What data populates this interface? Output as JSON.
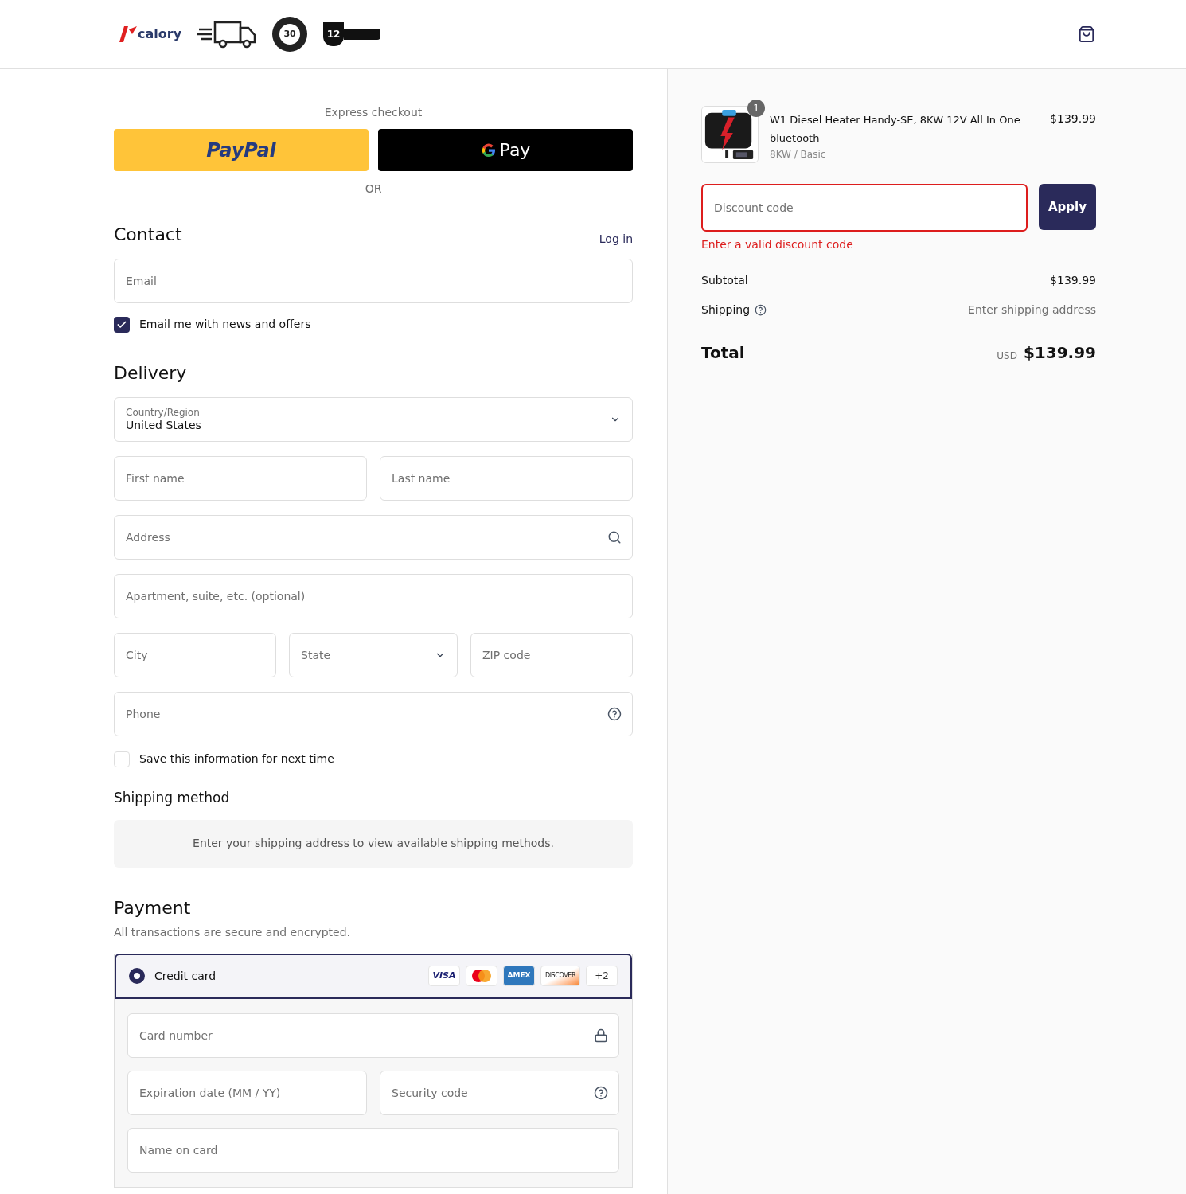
{
  "header": {
    "logo": "calory",
    "badges": [
      {
        "kind": "truck"
      },
      {
        "kind": "days",
        "text": "30"
      },
      {
        "kind": "warranty",
        "text": "12"
      }
    ]
  },
  "express": {
    "title": "Express checkout",
    "buttons": [
      {
        "kind": "paypal",
        "label": "PayPal"
      },
      {
        "kind": "gpay",
        "label": "Pay"
      }
    ],
    "divider": "OR"
  },
  "contact": {
    "heading": "Contact",
    "link": "Log in",
    "email": {
      "kind": "email",
      "placeholder": "Email"
    },
    "newsletter": {
      "label": "Email me with news and offers",
      "checked": true
    }
  },
  "delivery": {
    "heading": "Delivery",
    "rows": [
      [
        {
          "kind": "select",
          "label": "Country/Region",
          "value": "United States"
        }
      ],
      [
        {
          "kind": "input",
          "placeholder": "First name"
        },
        {
          "kind": "input",
          "placeholder": "Last name"
        }
      ],
      [
        {
          "kind": "address",
          "placeholder": "Address"
        }
      ],
      [
        {
          "kind": "input",
          "placeholder": "Apartment, suite, etc. (optional)"
        }
      ],
      [
        {
          "kind": "input",
          "placeholder": "City"
        },
        {
          "kind": "select",
          "placeholder": "State"
        },
        {
          "kind": "input",
          "placeholder": "ZIP code"
        }
      ],
      [
        {
          "kind": "phone",
          "placeholder": "Phone"
        }
      ]
    ],
    "save": {
      "label": "Save this information for next time",
      "checked": false
    }
  },
  "shipping_method": {
    "heading": "Shipping method",
    "notice": "Enter your shipping address to view available shipping methods."
  },
  "payment": {
    "heading": "Payment",
    "subtitle": "All transactions are secure and encrypted.",
    "method": {
      "label": "Credit card",
      "selected": true,
      "brands": [
        {
          "kind": "visa",
          "text": "VISA"
        },
        {
          "kind": "mastercard"
        },
        {
          "kind": "amex",
          "text": "AMEX"
        },
        {
          "kind": "discover",
          "text": "DISCOVER"
        },
        {
          "kind": "more",
          "text": "+2"
        }
      ]
    },
    "rows": [
      [
        {
          "kind": "card",
          "placeholder": "Card number"
        }
      ],
      [
        {
          "kind": "input",
          "placeholder": "Expiration date (MM / YY)"
        },
        {
          "kind": "cvc",
          "placeholder": "Security code"
        }
      ],
      [
        {
          "kind": "input",
          "placeholder": "Name on card"
        }
      ]
    ]
  },
  "summary": {
    "product": {
      "name": "W1 Diesel Heater Handy-SE, 8KW 12V All In One bluetooth",
      "variant": "8KW / Basic",
      "price": "$139.99",
      "quantity": "1"
    },
    "discount": {
      "placeholder": "Discount code",
      "invalid": true,
      "error": "Enter a valid discount code",
      "button": "Apply"
    },
    "lines": [
      {
        "kind": "plain",
        "label": "Subtotal",
        "value": "$139.99"
      },
      {
        "kind": "help",
        "label": "Shipping",
        "value": "Enter shipping address"
      }
    ],
    "total": {
      "label": "Total",
      "currency": "USD",
      "amount": "$139.99"
    }
  }
}
